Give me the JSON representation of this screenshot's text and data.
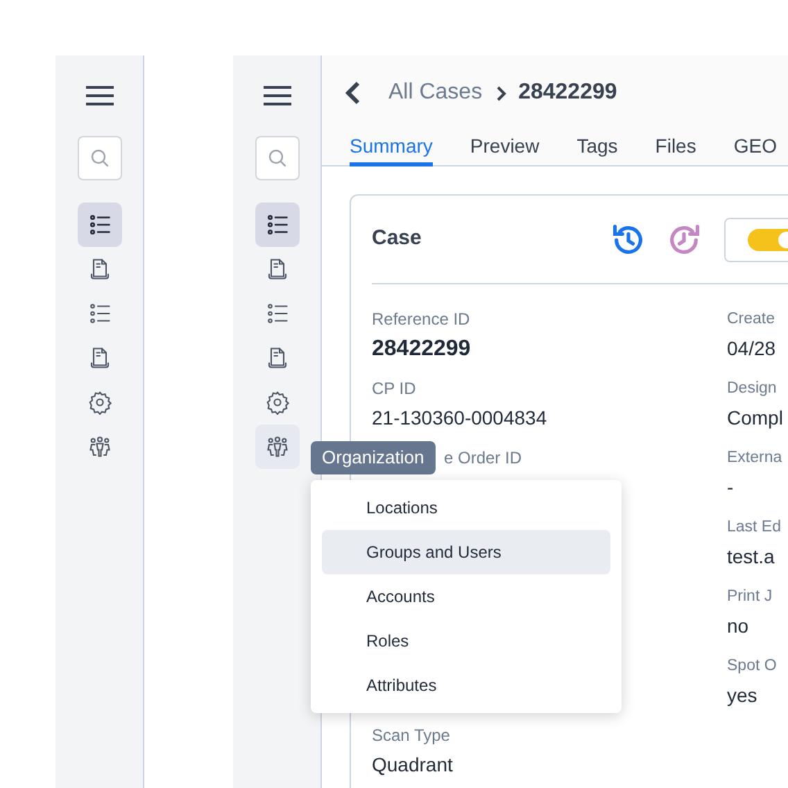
{
  "sidebars": [
    {
      "items": [
        {
          "kind": "list",
          "selected": true,
          "hovered": false
        },
        {
          "kind": "doc",
          "selected": false,
          "hovered": false
        },
        {
          "kind": "list",
          "selected": false,
          "hovered": false
        },
        {
          "kind": "doc",
          "selected": false,
          "hovered": false
        },
        {
          "kind": "gear",
          "selected": false,
          "hovered": false
        },
        {
          "kind": "people",
          "selected": false,
          "hovered": false
        }
      ]
    },
    {
      "items": [
        {
          "kind": "list",
          "selected": true,
          "hovered": false
        },
        {
          "kind": "doc",
          "selected": false,
          "hovered": false
        },
        {
          "kind": "list",
          "selected": false,
          "hovered": false
        },
        {
          "kind": "doc",
          "selected": false,
          "hovered": false
        },
        {
          "kind": "gear",
          "selected": false,
          "hovered": false
        },
        {
          "kind": "people",
          "selected": false,
          "hovered": true
        }
      ]
    }
  ],
  "breadcrumb": {
    "parent": "All Cases",
    "current": "28422299"
  },
  "tabs": [
    {
      "label": "Summary",
      "selected": true
    },
    {
      "label": "Preview",
      "selected": false
    },
    {
      "label": "Tags",
      "selected": false
    },
    {
      "label": "Files",
      "selected": false
    },
    {
      "label": "GEO",
      "selected": false
    }
  ],
  "card": {
    "title": "Case",
    "toggle_on": true,
    "left_fields": [
      {
        "kind": "primary",
        "label": "Reference ID",
        "value": "28422299"
      },
      {
        "kind": "plain",
        "label": "CP ID",
        "value": "21-130360-0004834"
      },
      {
        "kind": "covered",
        "label": "e Order ID"
      },
      {
        "kind": "plain",
        "label": "Scan Type",
        "value": "Quadrant"
      }
    ],
    "right_fields": [
      {
        "label": "Create",
        "value": "04/28"
      },
      {
        "label": "Design",
        "value": "Compl"
      },
      {
        "label": "Externa",
        "value": "-"
      },
      {
        "label": "Last Ed",
        "value": "test.a"
      },
      {
        "label": "Print J",
        "value": "no"
      },
      {
        "label": "Spot O",
        "value": "yes"
      }
    ]
  },
  "tooltip": "Organization",
  "menu": [
    {
      "label": "Locations",
      "selected": false
    },
    {
      "label": "Groups and Users",
      "selected": true
    },
    {
      "label": "Accounts",
      "selected": false
    },
    {
      "label": "Roles",
      "selected": false
    },
    {
      "label": "Attributes",
      "selected": false
    }
  ]
}
